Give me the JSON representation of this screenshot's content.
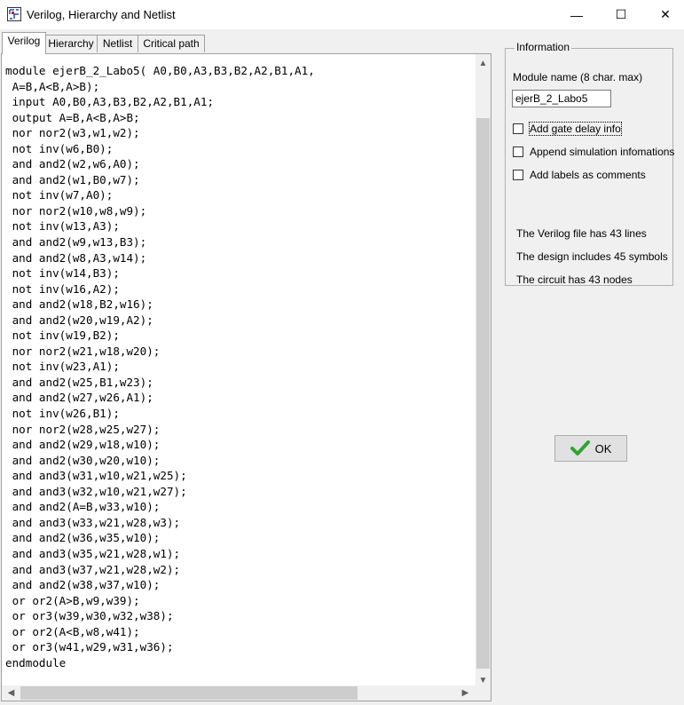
{
  "window": {
    "title": "Verilog, Hierarchy and Netlist",
    "minimize_glyph": "—",
    "maximize_glyph": "☐",
    "close_glyph": "✕"
  },
  "tabs": [
    {
      "label": "Verilog",
      "active": true
    },
    {
      "label": "Hierarchy",
      "active": false
    },
    {
      "label": "Netlist",
      "active": false
    },
    {
      "label": "Critical path",
      "active": false
    }
  ],
  "editor": {
    "code": "module ejerB_2_Labo5( A0,B0,A3,B3,B2,A2,B1,A1,\n A=B,A<B,A>B);\n input A0,B0,A3,B3,B2,A2,B1,A1;\n output A=B,A<B,A>B;\n nor nor2(w3,w1,w2);\n not inv(w6,B0);\n and and2(w2,w6,A0);\n and and2(w1,B0,w7);\n not inv(w7,A0);\n nor nor2(w10,w8,w9);\n not inv(w13,A3);\n and and2(w9,w13,B3);\n and and2(w8,A3,w14);\n not inv(w14,B3);\n not inv(w16,A2);\n and and2(w18,B2,w16);\n and and2(w20,w19,A2);\n not inv(w19,B2);\n nor nor2(w21,w18,w20);\n not inv(w23,A1);\n and and2(w25,B1,w23);\n and and2(w27,w26,A1);\n not inv(w26,B1);\n nor nor2(w28,w25,w27);\n and and2(w29,w18,w10);\n and and2(w30,w20,w10);\n and and3(w31,w10,w21,w25);\n and and3(w32,w10,w21,w27);\n and and2(A=B,w33,w10);\n and and3(w33,w21,w28,w3);\n and and2(w36,w35,w10);\n and and3(w35,w21,w28,w1);\n and and3(w37,w21,w28,w2);\n and and2(w38,w37,w10);\n or or2(A>B,w9,w39);\n or or3(w39,w30,w32,w38);\n or or2(A<B,w8,w41);\n or or3(w41,w29,w31,w36);\nendmodule"
  },
  "info": {
    "legend": "Information",
    "module_name_label": "Module name  (8 char. max)",
    "module_name_value": "ejerB_2_Labo5",
    "options": [
      {
        "label": "Add gate delay info",
        "checked": false
      },
      {
        "label": "Append simulation infomations",
        "checked": false
      },
      {
        "label": "Add labels as comments",
        "checked": false
      }
    ],
    "stats": [
      "The Verilog file has 43 lines",
      "The design includes 45 symbols",
      "The circuit has 43 nodes"
    ]
  },
  "ok_button": {
    "label": "OK",
    "icon": "checkmark-icon",
    "icon_color": "#2fa52f"
  }
}
